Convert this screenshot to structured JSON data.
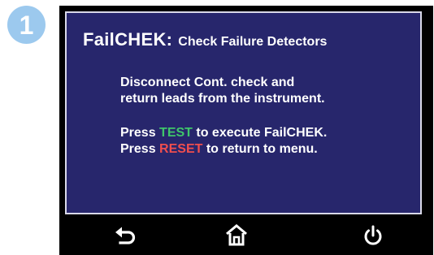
{
  "step": {
    "number": "1",
    "color": "#9cc9ee"
  },
  "screen": {
    "background": "#27266c",
    "title": "FailCHEK:",
    "subtitle": "Check Failure Detectors",
    "instruction_line1": "Disconnect Cont. check and",
    "instruction_line2": "return leads from the instrument.",
    "press_test": {
      "prefix": "Press ",
      "highlight": "TEST",
      "suffix": " to execute FailCHEK.",
      "highlight_color": "#3fc66a"
    },
    "press_reset": {
      "prefix": "Press ",
      "highlight": "RESET",
      "suffix": " to return to menu.",
      "highlight_color": "#f04e4e"
    }
  },
  "navbar": {
    "buttons": [
      {
        "icon": "back-arrow-icon"
      },
      {
        "icon": "home-icon"
      },
      {
        "icon": "power-icon"
      }
    ]
  }
}
